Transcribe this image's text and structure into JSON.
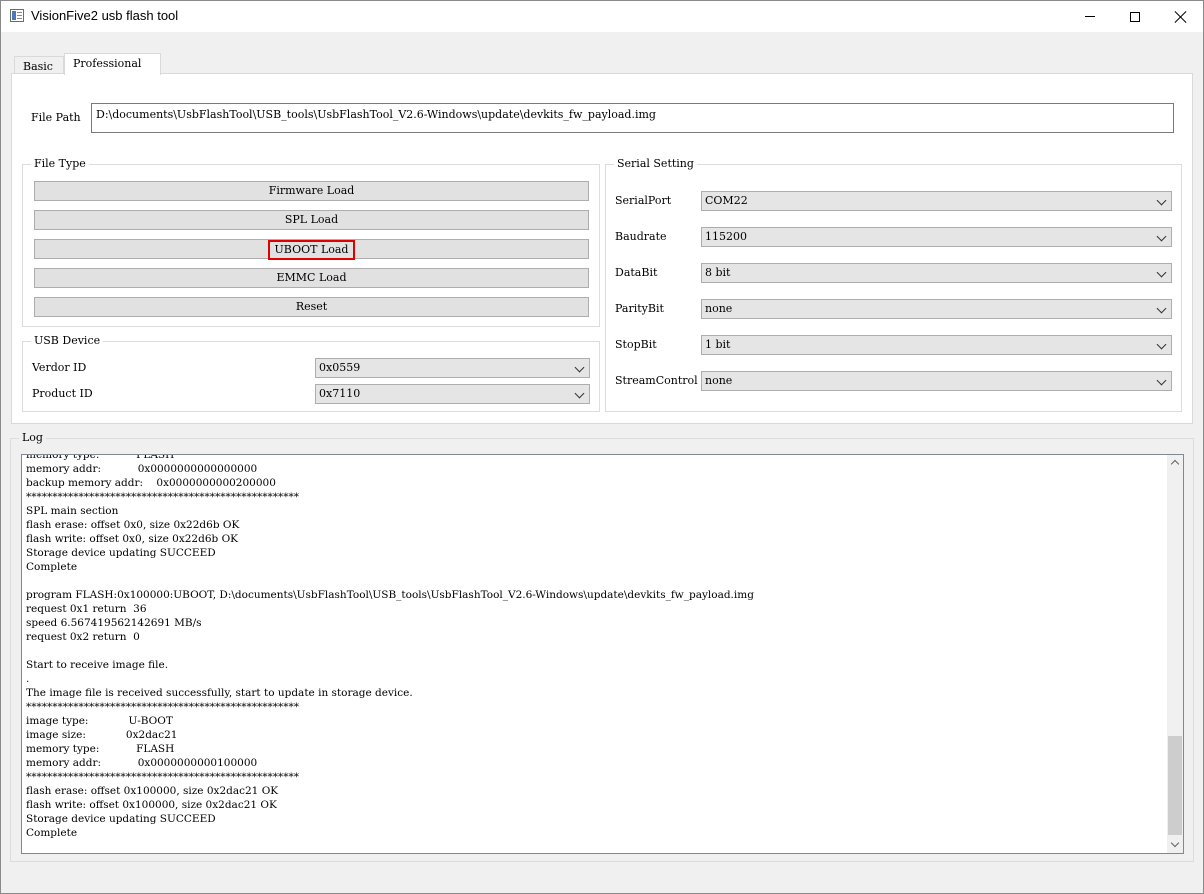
{
  "window": {
    "title": "VisionFive2 usb flash tool"
  },
  "tabs": [
    {
      "label": "Basic"
    },
    {
      "label": "Professional"
    }
  ],
  "file_path": {
    "label": "File Path",
    "value": "D:\\documents\\UsbFlashTool\\USB_tools\\UsbFlashTool_V2.6-Windows\\update\\devkits_fw_payload.img"
  },
  "file_type": {
    "title": "File Type",
    "buttons": [
      {
        "label": "Firmware Load"
      },
      {
        "label": "SPL Load"
      },
      {
        "label": "UBOOT Load"
      },
      {
        "label": "EMMC Load"
      },
      {
        "label": "Reset"
      }
    ]
  },
  "usb_device": {
    "title": "USB Device",
    "vendor_id": {
      "label": "Verdor ID",
      "value": "0x0559"
    },
    "product_id": {
      "label": "Product ID",
      "value": "0x7110"
    }
  },
  "serial_setting": {
    "title": "Serial Setting",
    "fields": [
      {
        "label": "SerialPort",
        "value": "COM22"
      },
      {
        "label": "Baudrate",
        "value": "115200"
      },
      {
        "label": "DataBit",
        "value": "8 bit"
      },
      {
        "label": "ParityBit",
        "value": "none"
      },
      {
        "label": "StopBit",
        "value": "1 bit"
      },
      {
        "label": "StreamControl",
        "value": "none"
      }
    ]
  },
  "log": {
    "title": "Log",
    "lines": [
      "memory type:           FLASH",
      "memory addr:           0x0000000000000000",
      "backup memory addr:    0x0000000000200000",
      "****************************************************",
      "SPL main section",
      "flash erase: offset 0x0, size 0x22d6b OK",
      "flash write: offset 0x0, size 0x22d6b OK",
      "Storage device updating SUCCEED",
      "Complete",
      "",
      "program FLASH:0x100000:UBOOT, D:\\documents\\UsbFlashTool\\USB_tools\\UsbFlashTool_V2.6-Windows\\update\\devkits_fw_payload.img",
      "request 0x1 return  36",
      "speed 6.567419562142691 MB/s",
      "request 0x2 return  0",
      "",
      "Start to receive image file.",
      ".",
      "The image file is received successfully, start to update in storage device.",
      "****************************************************",
      "image type:            U-BOOT",
      "image size:            0x2dac21",
      "memory type:           FLASH",
      "memory addr:           0x0000000000100000",
      "****************************************************",
      "flash erase: offset 0x100000, size 0x2dac21 OK",
      "flash write: offset 0x100000, size 0x2dac21 OK",
      "Storage device updating SUCCEED",
      "Complete"
    ]
  },
  "colors": {
    "highlight": "#e00000"
  }
}
